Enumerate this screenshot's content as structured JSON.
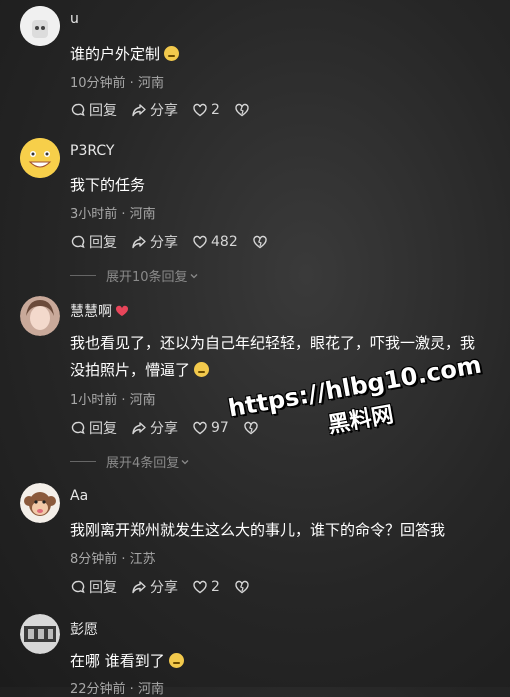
{
  "comments": [
    {
      "user": "u",
      "text": "谁的户外定制",
      "meta": "10分钟前 · 河南",
      "reply": "回复",
      "share": "分享",
      "likes": "2"
    },
    {
      "user": "P3RCY",
      "text": "我下的任务",
      "meta": "3小时前 · 河南",
      "reply": "回复",
      "share": "分享",
      "likes": "482",
      "expand": "展开10条回复"
    },
    {
      "user": "慧慧啊",
      "text_line1": "我也看见了，还以为自己年纪轻轻，眼花了，吓我一激灵，我",
      "text_line2": "没拍照片，懵逼了",
      "meta": "1小时前 · 河南",
      "reply": "回复",
      "share": "分享",
      "likes": "97",
      "expand": "展开4条回复"
    },
    {
      "user": "Aa",
      "text": "我刚离开郑州就发生这么大的事儿，谁下的命令？回答我",
      "meta": "8分钟前 · 江苏",
      "reply": "回复",
      "share": "分享",
      "likes": "2"
    },
    {
      "user": "彭愿",
      "text": "在哪 谁看到了",
      "meta": "22分钟前 · 河南"
    }
  ],
  "watermark": {
    "url": "https://hlbg10.com",
    "name": "黑料网"
  },
  "icons": {
    "reply": "comment-bubble-icon",
    "share": "share-arrow-icon",
    "like": "heart-icon",
    "dislike": "broken-heart-icon",
    "expand": "chevron-down-icon"
  }
}
